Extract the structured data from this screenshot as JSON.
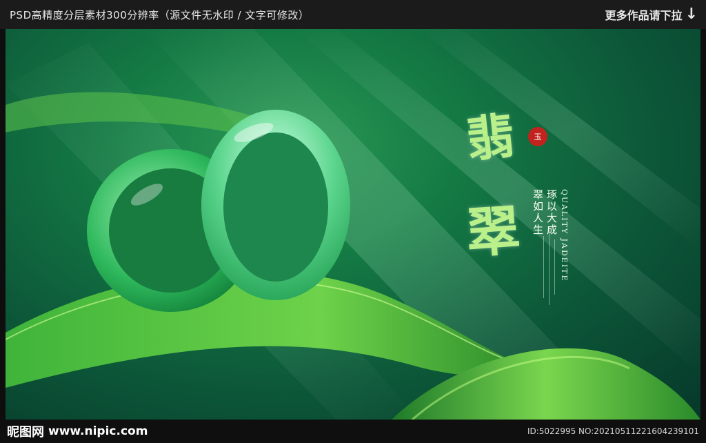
{
  "header": {
    "left_text": "PSD高精度分层素材300分辨率（源文件无水印 / 文字可修改）",
    "right_text": "更多作品请下拉"
  },
  "poster": {
    "title_char_1": "翡",
    "title_char_2": "翠",
    "seal_text": "玉",
    "vertical_line_1": "琢以大成",
    "vertical_line_2": "翠如人生",
    "english_text": "QUALITY JADEITE"
  },
  "footer": {
    "logo_cn": "昵图网",
    "logo_url": "www.nipic.com",
    "id_text": "ID:5022995 NO:20210511221604239101"
  },
  "icons": [
    "down-arrow-icon",
    "jade-bangle-illustration",
    "leaf-illustration"
  ],
  "colors": {
    "jade_green": "#2eb85c",
    "title_green": "#b9f08a",
    "seal_red": "#c2231e"
  }
}
